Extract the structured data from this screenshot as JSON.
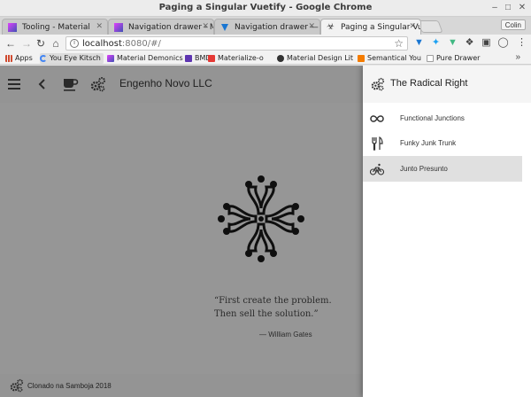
{
  "window": {
    "title": "Paging a Singular Vuetify - Google Chrome"
  },
  "tabs": [
    {
      "label": "Tooling - Material"
    },
    {
      "label": "Navigation drawer - M"
    },
    {
      "label": "Navigation drawer —"
    },
    {
      "label": "Paging a Singular Vue"
    }
  ],
  "profile_label": "Colin",
  "address": {
    "host": "localhost",
    "rest": ":8080/#/"
  },
  "bookmarks": [
    {
      "label": "Apps",
      "color": "#d04a2f"
    },
    {
      "label": "You Eye Kitsch",
      "color": "#4285f4"
    },
    {
      "label": "Material Demonics",
      "color": "#9c27b0"
    },
    {
      "label": "BMD",
      "color": "#5e35b1"
    },
    {
      "label": "Materialize-o",
      "color": "#e53935"
    },
    {
      "label": "Material Design Lit",
      "color": "#333333"
    },
    {
      "label": "Semantical You",
      "color": "#f57c00"
    },
    {
      "label": "Pure Drawer",
      "color": "#9e9e9e"
    }
  ],
  "app": {
    "title": "Engenho Novo LLC",
    "quote_line1": "“First create the problem.",
    "quote_line2": "Then sell the solution.”",
    "author": "— William Gates",
    "footer": "Clonado na Samboja 2018"
  },
  "drawer": {
    "title": "The Radical Right",
    "items": [
      {
        "label": "Functional Junctions",
        "icon": "infinity-icon"
      },
      {
        "label": "Funky Junk Trunk",
        "icon": "restaurant-icon"
      },
      {
        "label": "Junto Presunto",
        "icon": "bike-icon"
      }
    ],
    "selected_index": 2
  }
}
